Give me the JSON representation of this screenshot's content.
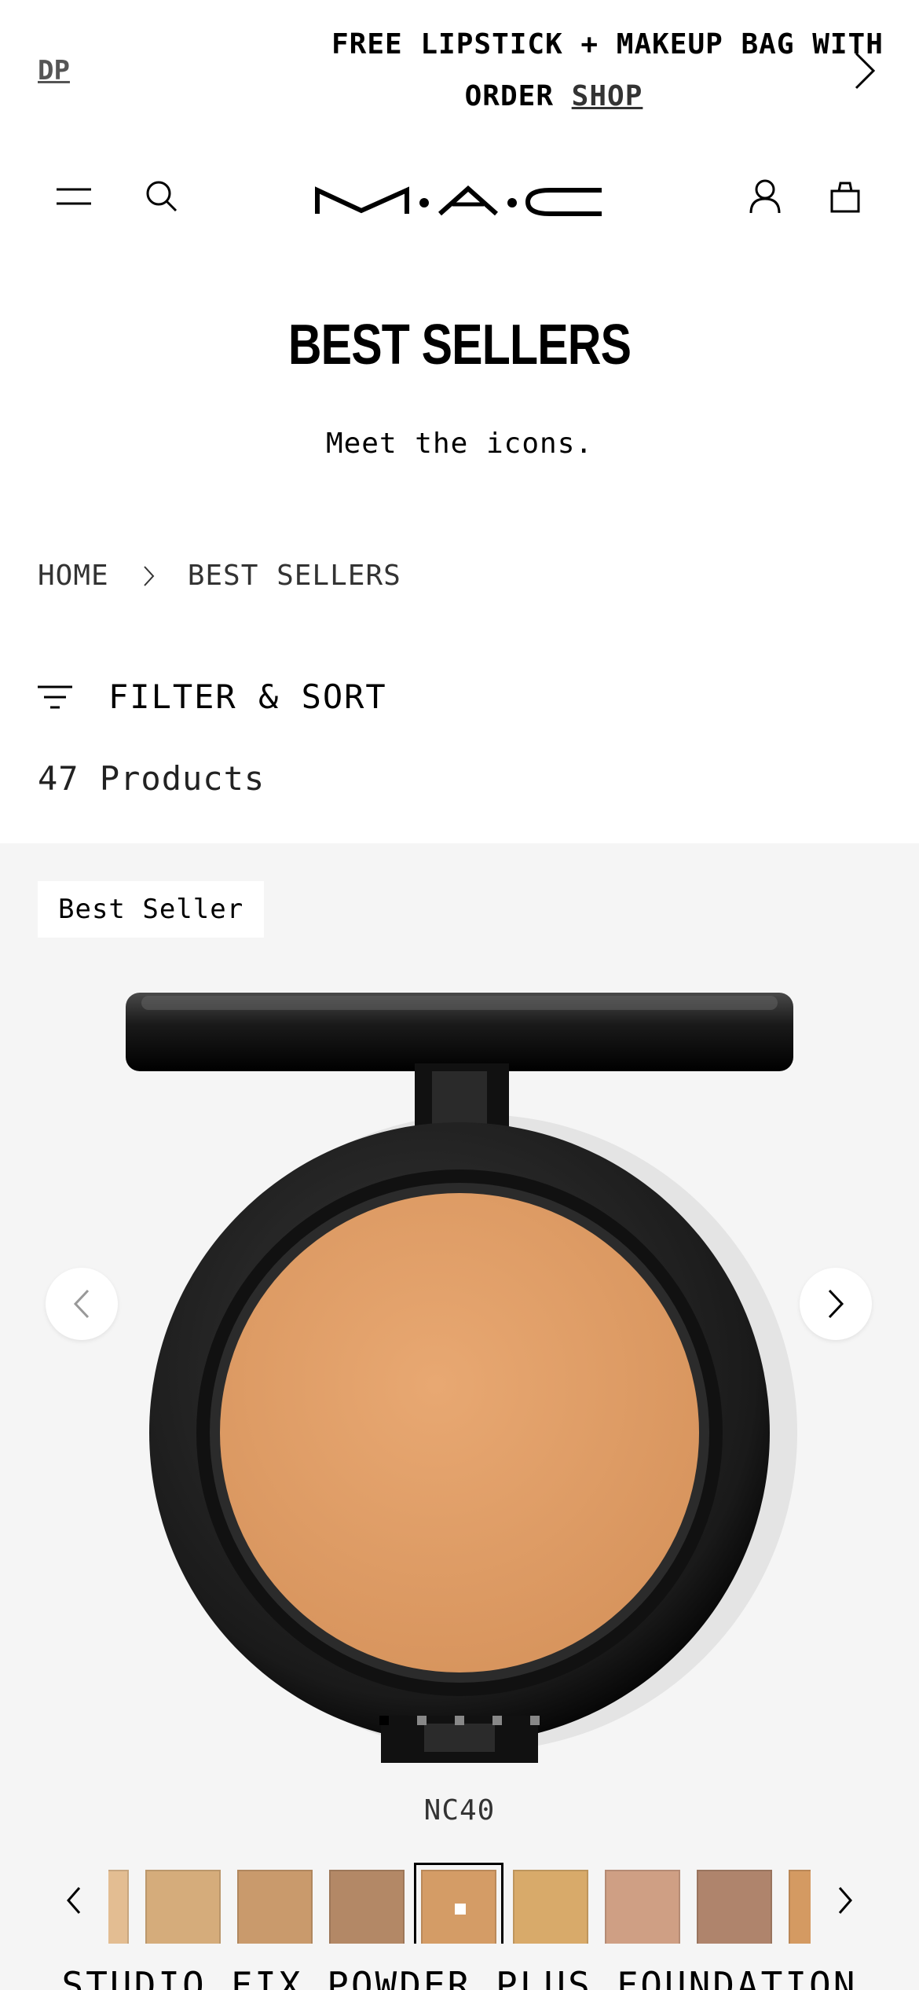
{
  "promo": {
    "prev_label": "DP",
    "line1": "FREE LIPSTICK + MAKEUP BAG WITH S",
    "line2_prefix": "ORDER ",
    "line2_link": "SHOP"
  },
  "header": {
    "logo_alt": "M·A·C",
    "icons": [
      "menu-icon",
      "search-icon",
      "account-icon",
      "shopping-bag-icon"
    ]
  },
  "page": {
    "title": "BEST SELLERS",
    "subtitle": "Meet the icons."
  },
  "breadcrumb": {
    "home": "HOME",
    "current": "BEST SELLERS"
  },
  "filter": {
    "label": "FILTER & SORT",
    "count": "47 Products"
  },
  "product": {
    "badge": "Best Seller",
    "shade": "NC40",
    "name": "STUDIO FIX POWDER PLUS FOUNDATION",
    "image_count": 5,
    "active_image": 0,
    "swatches": [
      {
        "color": "#e3bd92"
      },
      {
        "color": "#d5ac7b"
      },
      {
        "color": "#c99a6c"
      },
      {
        "color": "#b38866"
      },
      {
        "color": "#d49c66",
        "selected": true
      },
      {
        "color": "#d8aa6a"
      },
      {
        "color": "#cf9f84"
      },
      {
        "color": "#af846c"
      },
      {
        "color": "#d49a62"
      }
    ]
  },
  "colors": {
    "card_bg": "#f5f5f5",
    "powder": "#e0a068"
  }
}
